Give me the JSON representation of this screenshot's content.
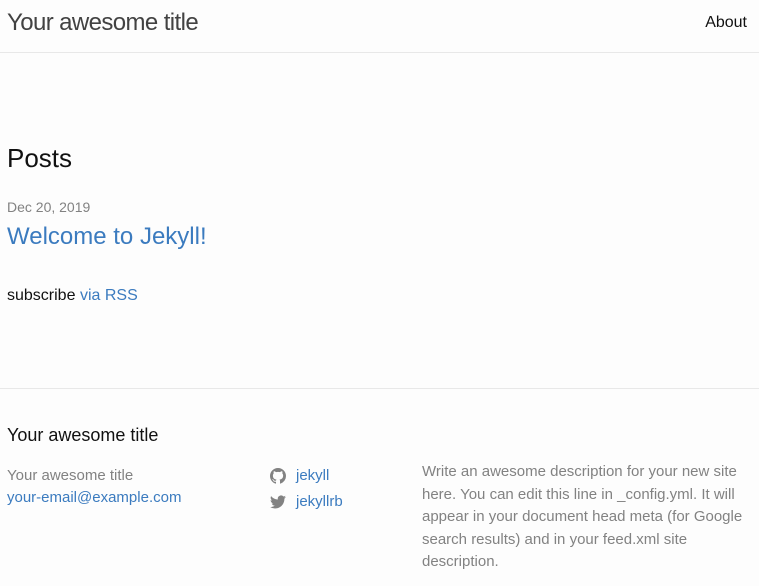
{
  "header": {
    "site_title": "Your awesome title",
    "nav": [
      {
        "label": "About"
      }
    ]
  },
  "main": {
    "heading": "Posts",
    "posts": [
      {
        "date": "Dec 20, 2019",
        "title": "Welcome to Jekyll!"
      }
    ],
    "rss": {
      "prefix": "subscribe",
      "link_label": "via RSS"
    }
  },
  "footer": {
    "heading": "Your awesome title",
    "contact": {
      "name": "Your awesome title",
      "email": "your-email@example.com"
    },
    "social": [
      {
        "icon": "github-icon",
        "label": "jekyll"
      },
      {
        "icon": "twitter-icon",
        "label": "jekyllrb"
      }
    ],
    "description": "Write an awesome description for your new site here. You can edit this line in _config.yml. It will appear in your document head meta (for Google search results) and in your feed.xml site description."
  },
  "colors": {
    "link": "#3b7bbf",
    "muted": "#828282",
    "text": "#111111",
    "border": "#e8e8e8",
    "background": "#fdfdfd"
  }
}
